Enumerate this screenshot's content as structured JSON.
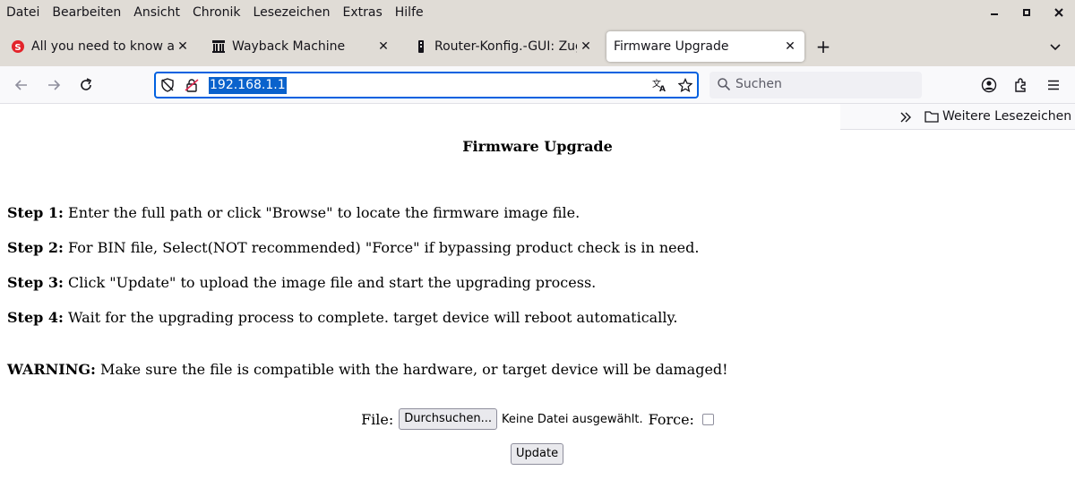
{
  "menubar": {
    "items": [
      "Datei",
      "Bearbeiten",
      "Ansicht",
      "Chronik",
      "Lesezeichen",
      "Extras",
      "Hilfe"
    ]
  },
  "window_controls": {
    "minimize": "–",
    "maximize": "▪",
    "close": "✕"
  },
  "tabs": [
    {
      "title": "All you need to know abo",
      "icon": "red-s-favicon-icon",
      "active": false
    },
    {
      "title": "Wayback Machine",
      "icon": "wayback-machine-icon",
      "active": false
    },
    {
      "title": "Router-Konfig.-GUI: Zuga",
      "icon": "router-icon",
      "active": false
    },
    {
      "title": "Firmware Upgrade",
      "icon": "none",
      "active": true
    }
  ],
  "tab_close_glyph": "✕",
  "new_tab_glyph": "+",
  "urlbar": {
    "url": "192.168.1.1"
  },
  "search": {
    "placeholder": "Suchen"
  },
  "bookmarks": {
    "folder_label": "Weitere Lesezeichen"
  },
  "page": {
    "title": "Firmware Upgrade",
    "steps": [
      {
        "label": "Step 1:",
        "text": " Enter the full path or click \"Browse\" to locate the firmware image file."
      },
      {
        "label": "Step 2:",
        "text": " For BIN file, Select(NOT recommended) \"Force\" if bypassing product check is in need."
      },
      {
        "label": "Step 3:",
        "text": " Click \"Update\" to upload the image file and start the upgrading process."
      },
      {
        "label": "Step 4:",
        "text": " Wait for the upgrading process to complete. target device will reboot automatically."
      }
    ],
    "warning": {
      "label": "WARNING:",
      "text": " Make sure the file is compatible with the hardware, or target device will be damaged!"
    },
    "form": {
      "file_label": "File:",
      "browse_button": "Durchsuchen...",
      "no_file_text": "Keine Datei ausgewählt.",
      "force_label": "Force:",
      "force_checked": false,
      "update_button": "Update"
    }
  },
  "colors": {
    "chrome_bg": "#e0dcd6",
    "toolbar_bg": "#f9f9fb",
    "url_focus": "#0061e0",
    "url_selection": "#0a62cc"
  }
}
